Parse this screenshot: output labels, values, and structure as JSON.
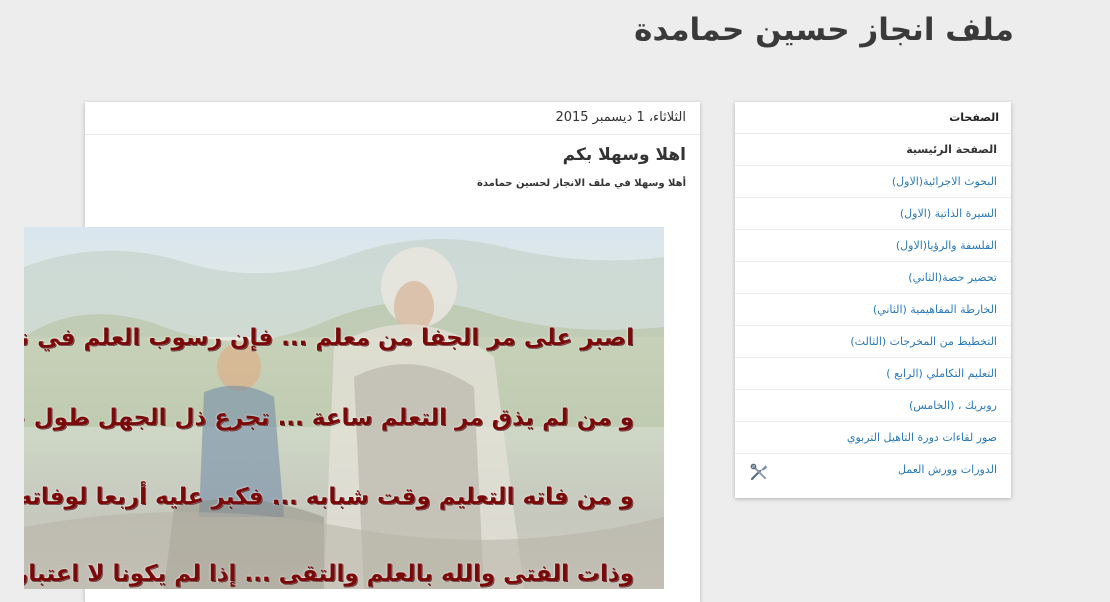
{
  "blog": {
    "title": "ملف انجاز حسين حمامدة"
  },
  "sidebar": {
    "header": "الصفحات",
    "items": [
      {
        "label": "الصفحة الرئيسية"
      },
      {
        "label": "البحوث الاجرائية(الاول)"
      },
      {
        "label": "السيرة الذاتية (الاول)"
      },
      {
        "label": "الفلسفة والرؤيا(الاول)"
      },
      {
        "label": "تحضير حصة(الثاني)"
      },
      {
        "label": "الخارطة المفاهيمية (الثاني)"
      },
      {
        "label": "التخطيط من المخرجات (الثالث)"
      },
      {
        "label": "التعليم التكاملي (الرابع )"
      },
      {
        "label": "روبريك ، (الخامس)"
      },
      {
        "label": "صور لقاءات دورة التاهيل التربوي"
      },
      {
        "label": "الدورات وورش العمل"
      }
    ],
    "edit_icon": "tools-icon"
  },
  "post": {
    "date": "الثلاثاء، 1 ديسمبر 2015",
    "title": "اهلا وسهلا بكم",
    "body": "أهلا وسهلا في ملف الانجاز لحسين حمامدة"
  },
  "poem": {
    "lines": [
      "اصبر على مر الجفا من معلم ... فإن رسوب العلم في نفراته",
      "و من لم يذق مر التعلم ساعة ... تجرع ذل الجهل طول حياته",
      "و من فاته التعليم وقت شبابه ... فكبر عليه أربعا لوفاته",
      "وذات الفتى والله بالعلم والتقى ... إذا لم يكونا لا اعتبار لذاته"
    ]
  }
}
